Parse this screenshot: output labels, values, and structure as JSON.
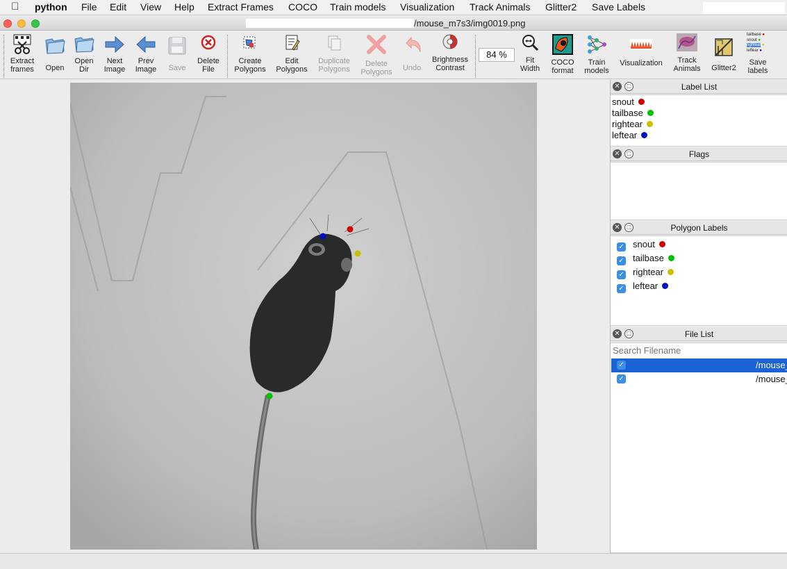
{
  "menubar": {
    "app_name": "python",
    "items": [
      "File",
      "Edit",
      "View",
      "Help",
      "Extract Frames",
      "COCO",
      "Train models",
      "Visualization",
      "Track Animals",
      "Glitter2",
      "Save Labels"
    ]
  },
  "window": {
    "title": "/mouse_m7s3/img0019.png"
  },
  "toolbar": {
    "buttons": [
      {
        "label": "Extract\nframes",
        "icon": "film-scissors-icon",
        "enabled": true
      },
      {
        "label": "Open",
        "icon": "folder-open-icon",
        "enabled": true
      },
      {
        "label": "Open\nDir",
        "icon": "folder-dir-icon",
        "enabled": true
      },
      {
        "label": "Next\nImage",
        "icon": "arrow-right-icon",
        "enabled": true
      },
      {
        "label": "Prev\nImage",
        "icon": "arrow-left-icon",
        "enabled": true
      },
      {
        "label": "Save",
        "icon": "floppy-icon",
        "enabled": false
      },
      {
        "label": "Delete\nFile",
        "icon": "delete-circle-icon",
        "enabled": true
      },
      {
        "label": "Create\nPolygons",
        "icon": "create-polygon-icon",
        "enabled": true
      },
      {
        "label": "Edit\nPolygons",
        "icon": "edit-polygon-icon",
        "enabled": true
      },
      {
        "label": "Duplicate\nPolygons",
        "icon": "duplicate-icon",
        "enabled": false
      },
      {
        "label": "Delete\nPolygons",
        "icon": "delete-x-icon",
        "enabled": false
      },
      {
        "label": "Undo",
        "icon": "undo-icon",
        "enabled": false
      },
      {
        "label": "Brightness\nContrast",
        "icon": "brightness-icon",
        "enabled": true
      },
      {
        "label": "Fit\nWidth",
        "icon": "fit-width-icon",
        "enabled": true
      },
      {
        "label": "COCO\nformat",
        "icon": "coco-icon",
        "enabled": true
      },
      {
        "label": "Train\nmodels",
        "icon": "network-icon",
        "enabled": true
      },
      {
        "label": "Visualization",
        "icon": "visualization-icon",
        "enabled": true
      },
      {
        "label": "Track\nAnimals",
        "icon": "track-animals-icon",
        "enabled": true
      },
      {
        "label": "Glitter2",
        "icon": "glitter-icon",
        "enabled": true
      },
      {
        "label": "Save\nlabels",
        "icon": "save-labels-icon",
        "enabled": true
      }
    ],
    "zoom_value": "84 %",
    "save_labels_icon_text": [
      "tailbase",
      "snout",
      "rightear",
      "leftear"
    ]
  },
  "label_list": {
    "title": "Label List",
    "items": [
      {
        "name": "snout",
        "color": "#d00000"
      },
      {
        "name": "tailbase",
        "color": "#00c000"
      },
      {
        "name": "rightear",
        "color": "#c8c000"
      },
      {
        "name": "leftear",
        "color": "#0010c8"
      }
    ]
  },
  "flags": {
    "title": "Flags"
  },
  "polygon_labels": {
    "title": "Polygon Labels",
    "items": [
      {
        "name": "snout",
        "color": "#d00000",
        "checked": true
      },
      {
        "name": "tailbase",
        "color": "#00c000",
        "checked": true
      },
      {
        "name": "rightear",
        "color": "#c8c000",
        "checked": true
      },
      {
        "name": "leftear",
        "color": "#0010c8",
        "checked": true
      }
    ]
  },
  "file_list": {
    "title": "File List",
    "search_placeholder": "Search Filename",
    "rows": [
      {
        "tail": "/mouse_",
        "selected": true,
        "checked": true
      },
      {
        "tail": "/mouse_",
        "selected": false,
        "checked": true
      }
    ]
  },
  "canvas": {
    "keypoints": [
      {
        "label": "snout",
        "color": "#d00000"
      },
      {
        "label": "leftear",
        "color": "#0010c8"
      },
      {
        "label": "rightear",
        "color": "#c8c000"
      },
      {
        "label": "tailbase",
        "color": "#00c000"
      }
    ]
  }
}
